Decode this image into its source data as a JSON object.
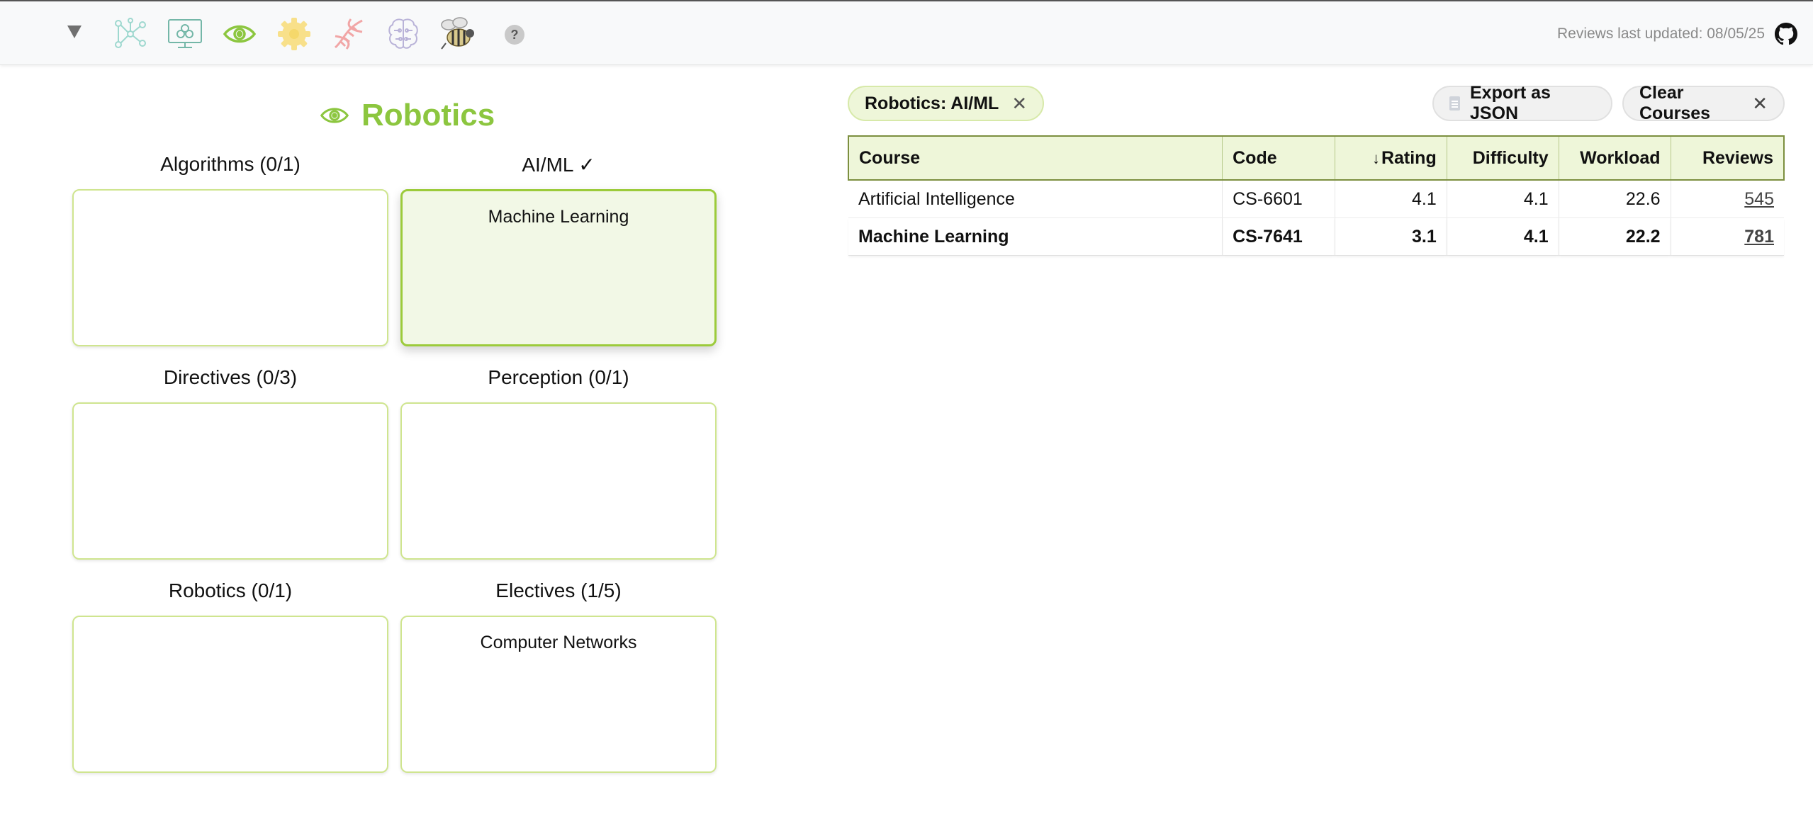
{
  "topbar": {
    "menu_icon": "caret-down-icon",
    "specializations": [
      {
        "icon": "network-graph-icon",
        "color": "#9ed8cf",
        "active": false
      },
      {
        "icon": "monitor-icon",
        "color": "#74b7a8",
        "active": false
      },
      {
        "icon": "eye-icon",
        "color": "#8cc63f",
        "active": true
      },
      {
        "icon": "gear-icon",
        "color": "#f5d86b",
        "active": false
      },
      {
        "icon": "dna-icon",
        "color": "#f1a6a6",
        "active": false
      },
      {
        "icon": "brain-icon",
        "color": "#b9b3d8",
        "active": false
      },
      {
        "icon": "bee-icon",
        "color": "#b3a369",
        "active": false
      }
    ],
    "help_label": "?",
    "updated_text": "Reviews last updated: 08/05/25",
    "github_icon": "github-icon"
  },
  "track": {
    "title": "Robotics",
    "icon": "eye-icon",
    "color": "#8cc63f",
    "groups": [
      {
        "label": "Algorithms (0/1)",
        "courses": []
      },
      {
        "label": "AI/ML ✓",
        "courses": [
          "Machine Learning"
        ],
        "complete": true
      },
      {
        "label": "Directives (0/3)",
        "courses": []
      },
      {
        "label": "Perception (0/1)",
        "courses": []
      },
      {
        "label": "Robotics (0/1)",
        "courses": []
      },
      {
        "label": "Electives (1/5)",
        "courses": [
          "Computer Networks"
        ]
      }
    ]
  },
  "filter_chip": {
    "label": "Robotics: AI/ML",
    "remove_icon": "close-icon"
  },
  "actions": {
    "export_label": "Export as JSON",
    "export_icon": "file-icon",
    "clear_label": "Clear Courses",
    "clear_icon": "close-icon"
  },
  "table": {
    "columns": [
      "Course",
      "Code",
      "Rating",
      "Difficulty",
      "Workload",
      "Reviews"
    ],
    "sort": {
      "column": "Rating",
      "direction": "descending",
      "icon": "arrow-down-icon"
    },
    "rows": [
      {
        "course": "Artificial Intelligence",
        "code": "CS-6601",
        "rating": "4.1",
        "difficulty": "4.1",
        "workload": "22.6",
        "reviews": "545",
        "selected": false
      },
      {
        "course": "Machine Learning",
        "code": "CS-7641",
        "rating": "3.1",
        "difficulty": "4.1",
        "workload": "22.2",
        "reviews": "781",
        "selected": true
      }
    ]
  },
  "colors": {
    "accent": "#8cc63f",
    "box_border": "#cfe58f",
    "header_bg": "#eef6d9"
  }
}
